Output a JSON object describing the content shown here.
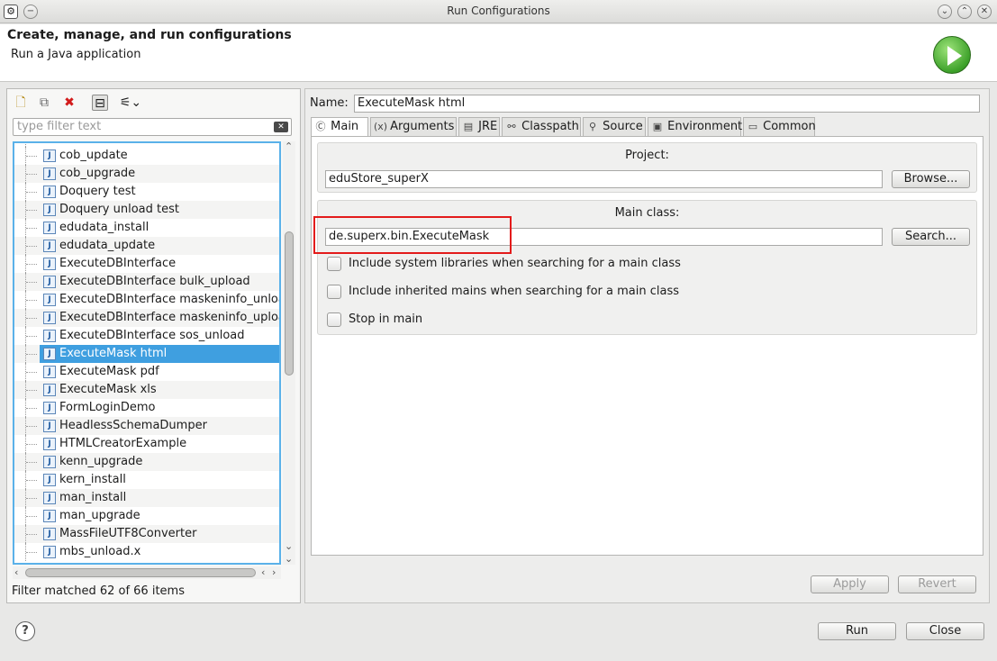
{
  "window": {
    "title": "Run Configurations",
    "buttons": [
      "minimize",
      "maximize",
      "close"
    ]
  },
  "header": {
    "title": "Create, manage, and run configurations",
    "subtitle": "Run a Java application",
    "icon": "run-play-icon"
  },
  "left": {
    "toolbar": [
      "new-configuration-icon",
      "duplicate-icon",
      "delete-icon",
      "collapse-all-icon",
      "filter-icon"
    ],
    "filter_placeholder": "type filter text",
    "items": [
      "cob_update",
      "cob_upgrade",
      "Doquery test",
      "Doquery unload test",
      "edudata_install",
      "edudata_update",
      "ExecuteDBInterface",
      "ExecuteDBInterface bulk_upload",
      "ExecuteDBInterface maskeninfo_unload",
      "ExecuteDBInterface maskeninfo_upload",
      "ExecuteDBInterface sos_unload",
      "ExecuteMask html",
      "ExecuteMask pdf",
      "ExecuteMask xls",
      "FormLoginDemo",
      "HeadlessSchemaDumper",
      "HTMLCreatorExample",
      "kenn_upgrade",
      "kern_install",
      "man_install",
      "man_upgrade",
      "MassFileUTF8Converter",
      "mbs_unload.x"
    ],
    "selected_index": 11,
    "status": "Filter matched 62 of 66 items"
  },
  "right": {
    "name_label": "Name:",
    "name_value": "ExecuteMask html",
    "tabs": [
      {
        "label": "Main",
        "icon": "main-tab-icon"
      },
      {
        "label": "Arguments",
        "icon": "arguments-icon"
      },
      {
        "label": "JRE",
        "icon": "jre-icon"
      },
      {
        "label": "Classpath",
        "icon": "classpath-icon"
      },
      {
        "label": "Source",
        "icon": "source-icon"
      },
      {
        "label": "Environment",
        "icon": "environment-icon"
      },
      {
        "label": "Common",
        "icon": "common-icon"
      }
    ],
    "project": {
      "title": "Project:",
      "value": "eduStore_superX",
      "browse": "Browse..."
    },
    "main_class": {
      "title": "Main class:",
      "value": "de.superx.bin.ExecuteMask",
      "search": "Search..."
    },
    "options": [
      "Include system libraries when searching for a main class",
      "Include inherited mains when searching for a main class",
      "Stop in main"
    ],
    "apply": "Apply",
    "revert": "Revert"
  },
  "footer": {
    "run": "Run",
    "close": "Close"
  },
  "colors": {
    "selection": "#3f9fe0",
    "highlight_box": "#e31b1b",
    "focus_border": "#5ab1e9"
  }
}
